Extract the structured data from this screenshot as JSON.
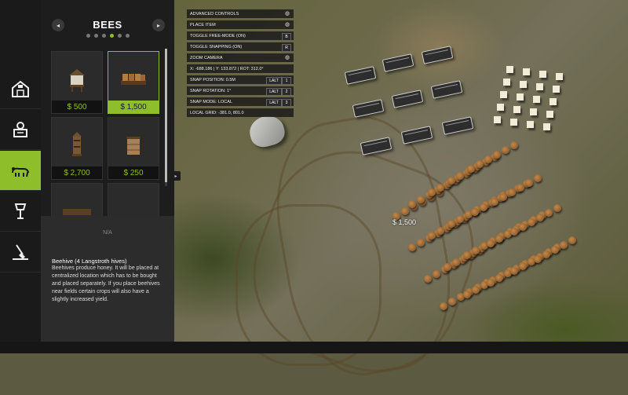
{
  "category": {
    "title": "BEES",
    "prev_icon": "◂",
    "next_icon": "▸",
    "page_count": 6,
    "active_page": 4
  },
  "sidebar_icons": [
    "farm-building-icon",
    "production-icon",
    "animals-icon",
    "lamp-decoration-icon",
    "landscaping-icon"
  ],
  "items": [
    {
      "price": "$ 500"
    },
    {
      "price": "$ 1,500",
      "selected": true
    },
    {
      "price": "$ 2,700"
    },
    {
      "price": "$ 250"
    }
  ],
  "details": {
    "na": "N/A",
    "name": "Beehive (4 Langstroth hives)",
    "description": "Beehives produce honey. It will be placed at centralized location which has to be bought and placed separately. If you place beehives near fields certain crops will also have a slightly increased yield."
  },
  "controls": {
    "header": "ADVANCED CONTROLS",
    "rows": [
      {
        "label": "PLACE ITEM",
        "icon": "mouse-left-icon"
      },
      {
        "label": "TOGGLE FREE-MODE (ON)",
        "key": "B"
      },
      {
        "label": "TOGGLE SNAPPING (ON)",
        "key": "R"
      },
      {
        "label": "ZOOM CAMERA",
        "icon": "mouse-wheel-icon"
      },
      {
        "label": "X: -688.186 | Y: 133.872 | ROT: 312.0°"
      },
      {
        "label": "SNAP POSITION: 0.5M",
        "mod": "LALT",
        "key": "1"
      },
      {
        "label": "SNAP ROTATION: 1°",
        "mod": "LALT",
        "key": "2"
      },
      {
        "label": "SNAP MODE: LOCAL",
        "mod": "LALT",
        "key": "3"
      },
      {
        "label": "LOCAL GRID: -381.0, 801.0"
      }
    ]
  },
  "world": {
    "placement_price": "$ 1,500"
  }
}
